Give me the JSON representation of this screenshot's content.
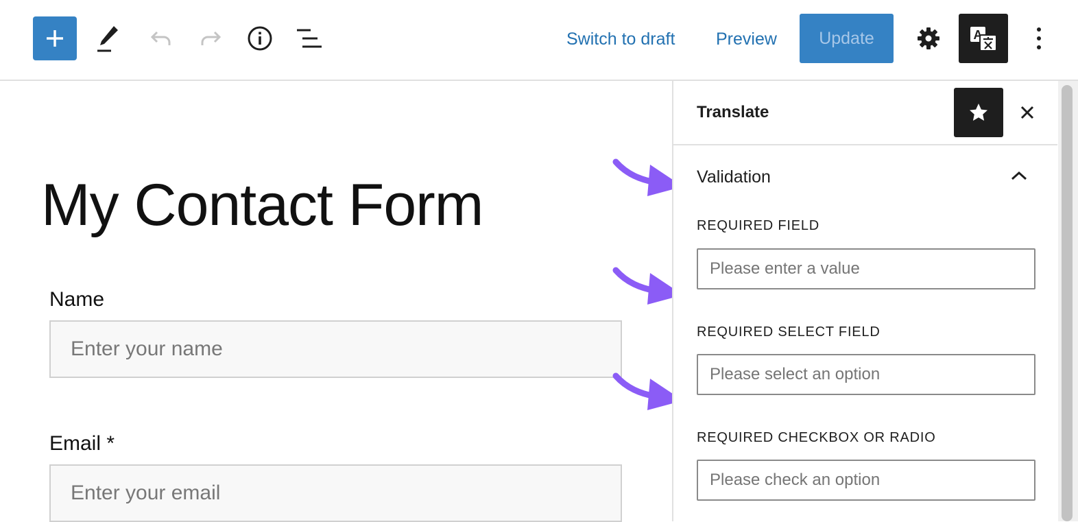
{
  "toolbar": {
    "add_icon": "plus-icon",
    "edit_icon": "pencil-icon",
    "undo_icon": "undo-icon",
    "redo_icon": "redo-icon",
    "info_icon": "info-icon",
    "list_icon": "list-view-icon",
    "switch_to_draft": "Switch to draft",
    "preview": "Preview",
    "update": "Update",
    "settings_icon": "gear-icon",
    "translate_icon": "translate-icon",
    "more_icon": "more-vertical-icon"
  },
  "editor": {
    "title": "My Contact Form",
    "fields": [
      {
        "label": "Name",
        "placeholder": "Enter your name"
      },
      {
        "label": "Email *",
        "placeholder": "Enter your email"
      }
    ]
  },
  "sidebar": {
    "title": "Translate",
    "star_icon": "star-icon",
    "close_icon": "close-icon",
    "panel_title": "Validation",
    "panel_icon": "chevron-up-icon",
    "fields": [
      {
        "label": "REQUIRED FIELD",
        "value": "Please enter a value"
      },
      {
        "label": "REQUIRED SELECT FIELD",
        "value": "Please select an option"
      },
      {
        "label": "REQUIRED CHECKBOX OR RADIO",
        "value": "Please check an option"
      }
    ]
  },
  "colors": {
    "accent": "#3582c4",
    "link": "#2271b1",
    "annotation_arrow": "#8b5cf6",
    "dark": "#1e1e1e"
  }
}
